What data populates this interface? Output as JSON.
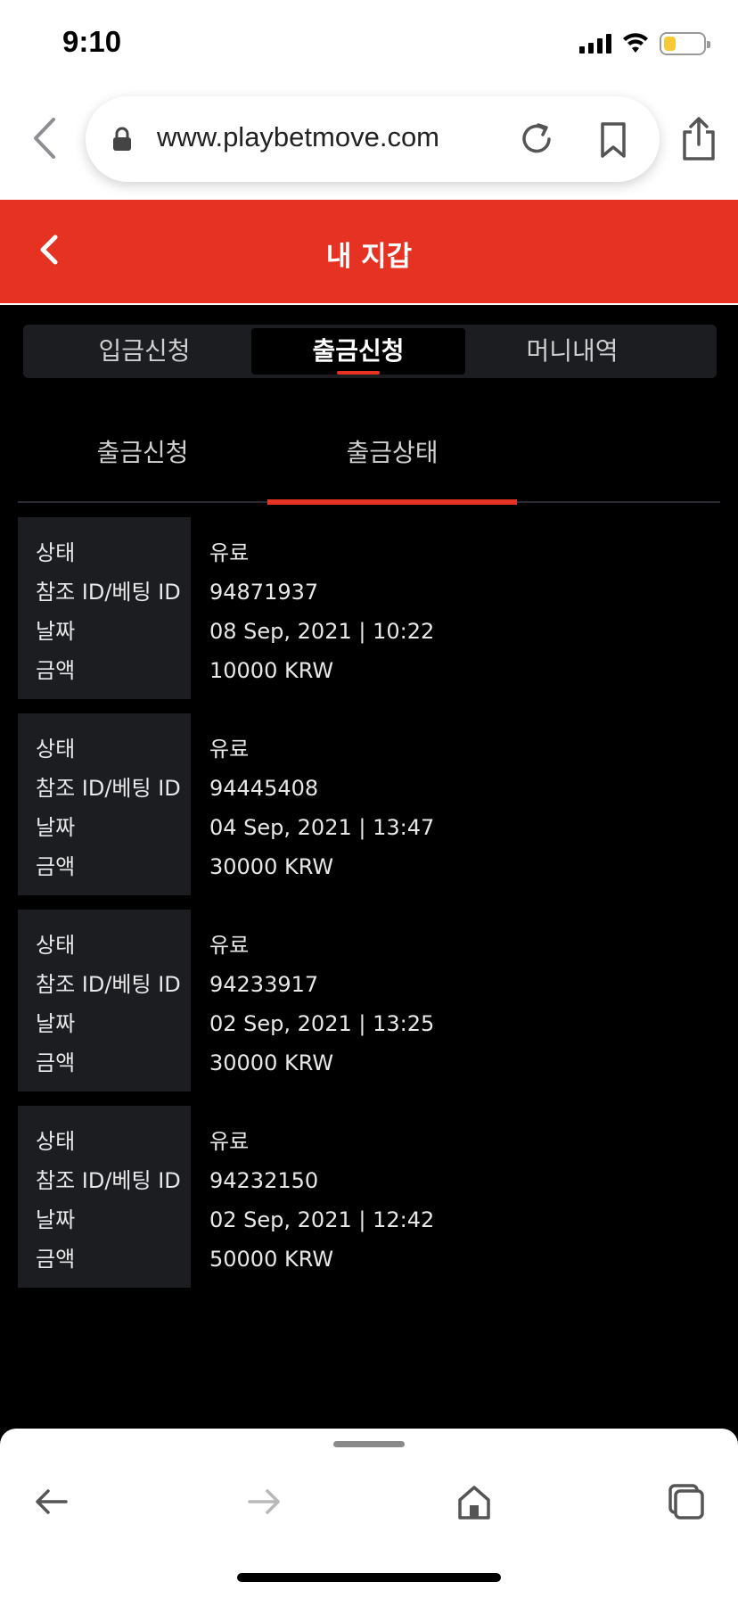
{
  "status_bar": {
    "time": "9:10"
  },
  "browser": {
    "url": "www.playbetmove.com"
  },
  "header": {
    "title": "내 지갑"
  },
  "main_tabs": [
    {
      "label": "입금신청",
      "active": false
    },
    {
      "label": "출금신청",
      "active": true
    },
    {
      "label": "머니내역",
      "active": false
    }
  ],
  "sub_tabs": [
    {
      "label": "출금신청",
      "active": false
    },
    {
      "label": "출금상태",
      "active": true
    }
  ],
  "record_labels": {
    "status": "상태",
    "ref_id": "참조 ID/베팅 ID",
    "date": "날짜",
    "amount": "금액"
  },
  "records": [
    {
      "status": "유료",
      "ref_id": "94871937",
      "date": "08 Sep, 2021 | 10:22",
      "amount": "10000 KRW"
    },
    {
      "status": "유료",
      "ref_id": "94445408",
      "date": "04 Sep, 2021 | 13:47",
      "amount": "30000 KRW"
    },
    {
      "status": "유료",
      "ref_id": "94233917",
      "date": "02 Sep, 2021 | 13:25",
      "amount": "30000 KRW"
    },
    {
      "status": "유료",
      "ref_id": "94232150",
      "date": "02 Sep, 2021 | 12:42",
      "amount": "50000 KRW"
    }
  ],
  "colors": {
    "accent": "#e63223",
    "background": "#000000",
    "panel": "#1c1d21"
  }
}
